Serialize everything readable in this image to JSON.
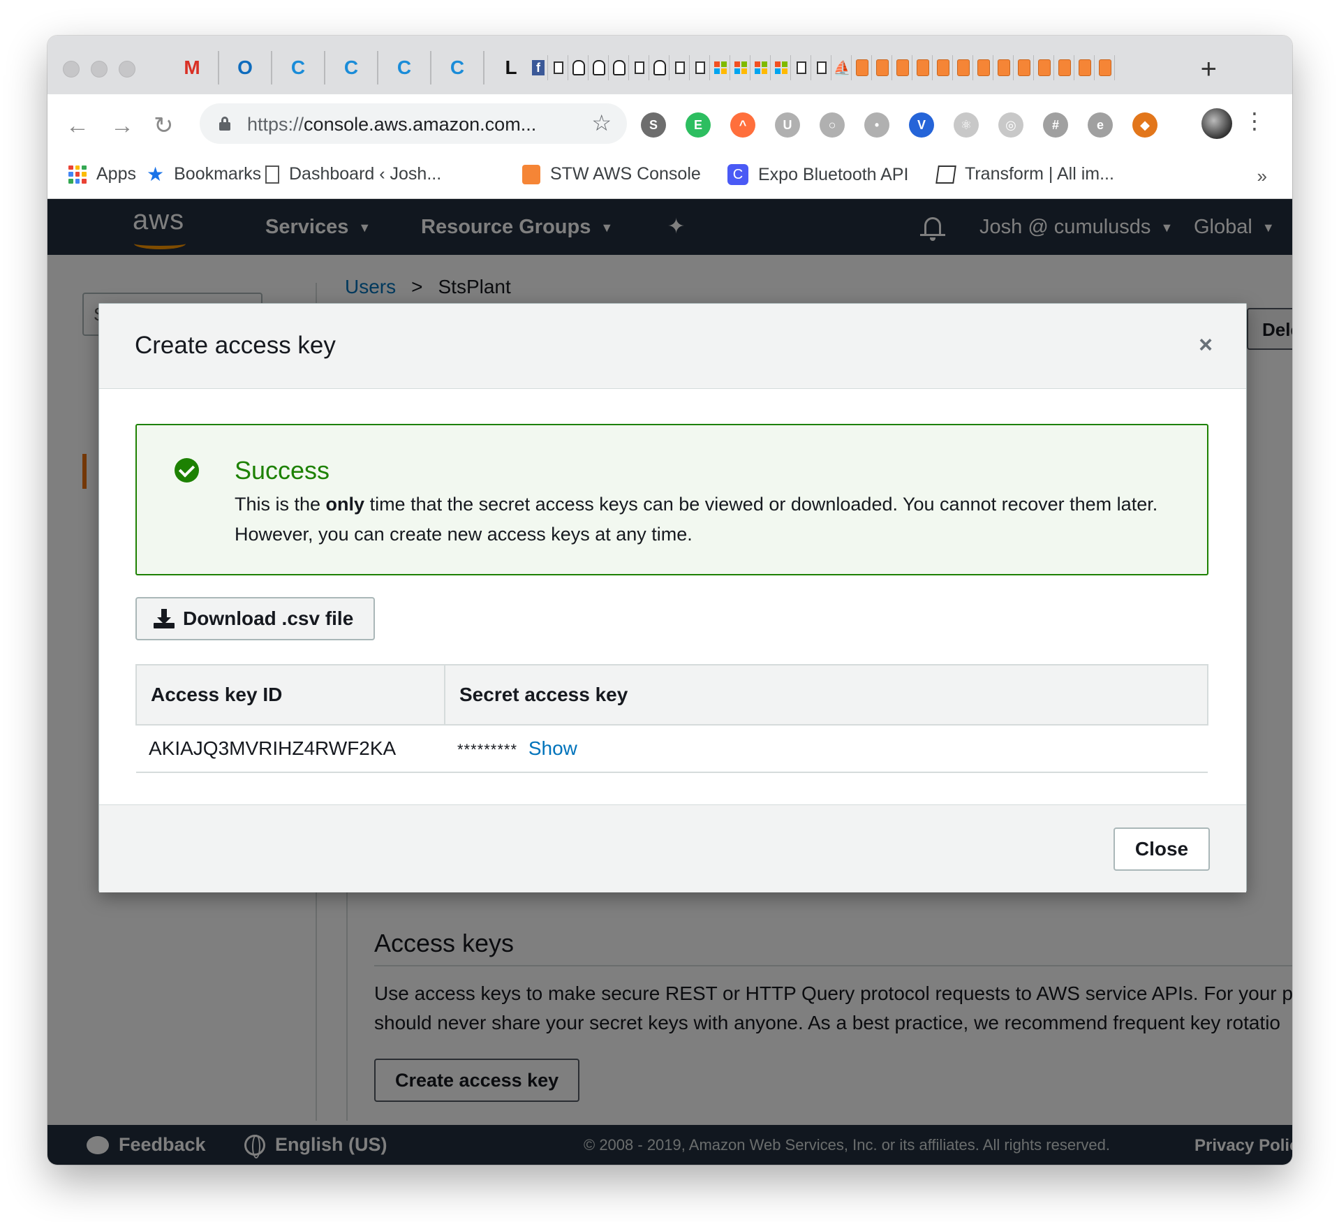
{
  "browser": {
    "pinned_tabs": [
      {
        "icon": "gmail-icon",
        "glyph": "M",
        "color": "#d93025"
      },
      {
        "icon": "outlook-icon",
        "glyph": "O",
        "color": "#0f6cbd"
      },
      {
        "icon": "c-app-icon",
        "glyph": "C",
        "color": "#1a8cd8"
      },
      {
        "icon": "c-app-icon",
        "glyph": "C",
        "color": "#1a8cd8"
      },
      {
        "icon": "c-app-icon",
        "glyph": "C",
        "color": "#1a8cd8"
      },
      {
        "icon": "c-app-icon",
        "glyph": "C",
        "color": "#1a8cd8"
      },
      {
        "icon": "l-app-icon",
        "glyph": "L",
        "color": "#111111"
      }
    ],
    "mini_tabs": [
      "facebook",
      "doc",
      "helmet",
      "helmet",
      "helmet",
      "doc",
      "helmet",
      "doc",
      "doc",
      "ms",
      "ms",
      "ms",
      "ms",
      "doc",
      "doc",
      "sail",
      "cube",
      "cube",
      "cube",
      "cube",
      "cube",
      "cube",
      "cube",
      "cube",
      "cube",
      "cube",
      "cube",
      "cube",
      "cube"
    ],
    "url_scheme": "https://",
    "url_rest": "console.aws.amazon.com...",
    "extensions": [
      {
        "icon": "s-extension-icon",
        "glyph": "S",
        "bg": "#6d6d6d"
      },
      {
        "icon": "evernote-icon",
        "glyph": "E",
        "bg": "#2dbe60"
      },
      {
        "icon": "rainbow-icon",
        "glyph": "^",
        "bg": "#ff6f3c"
      },
      {
        "icon": "u-extension-icon",
        "glyph": "U",
        "bg": "#b0b0b0"
      },
      {
        "icon": "circle-extension-icon",
        "glyph": "○",
        "bg": "#b0b0b0"
      },
      {
        "icon": "dot-extension-icon",
        "glyph": "•",
        "bg": "#b0b0b0"
      },
      {
        "icon": "vue-extension-icon",
        "glyph": "V",
        "bg": "#2564d8"
      },
      {
        "icon": "react-extension-icon",
        "glyph": "⚛",
        "bg": "#c8c8c8"
      },
      {
        "icon": "target-extension-icon",
        "glyph": "◎",
        "bg": "#c8c8c8"
      },
      {
        "icon": "tag-extension-icon",
        "glyph": "#",
        "bg": "#a0a0a0"
      },
      {
        "icon": "e-extension-icon",
        "glyph": "e",
        "bg": "#a0a0a0"
      },
      {
        "icon": "metamask-icon",
        "glyph": "◆",
        "bg": "#e2761b"
      }
    ],
    "bookmarks": [
      {
        "label": "Apps",
        "icon": "apps-grid-icon"
      },
      {
        "label": "Bookmarks",
        "icon": "star-icon"
      },
      {
        "label": "Dashboard ‹ Josh...",
        "icon": "page-icon"
      },
      {
        "label": "STW AWS Console",
        "icon": "aws-cube-icon"
      },
      {
        "label": "Expo Bluetooth API",
        "icon": "c-bookmark-icon"
      },
      {
        "label": "Transform | All im...",
        "icon": "transform-icon"
      }
    ],
    "bookmarks_more": "»"
  },
  "aws": {
    "logo_text": "aws",
    "nav": {
      "services": "Services",
      "resource_groups": "Resource Groups",
      "account": "Josh @ cumulusds",
      "region": "Global"
    },
    "search_placeholder": "Search IAM",
    "breadcrumb": {
      "users": "Users",
      "separator": ">",
      "current": "StsPlant"
    },
    "delete_button": "Dele",
    "access_keys": {
      "title": "Access keys",
      "desc_line1": "Use access keys to make secure REST or HTTP Query protocol requests to AWS service APIs. For your p",
      "desc_line2": "should never share your secret keys with anyone. As a best practice, we recommend frequent key rotatio",
      "create_button": "Create access key"
    },
    "footer": {
      "feedback": "Feedback",
      "language": "English (US)",
      "copyright": "© 2008 - 2019, Amazon Web Services, Inc. or its affiliates. All rights reserved.",
      "privacy": "Privacy Polic"
    }
  },
  "modal": {
    "title": "Create access key",
    "close_glyph": "×",
    "alert": {
      "title": "Success",
      "body_pre": "This is the ",
      "body_bold": "only",
      "body_post": " time that the secret access keys can be viewed or downloaded. You cannot recover them later. However, you can create new access keys at any time."
    },
    "download_button": "Download .csv file",
    "table": {
      "headers": [
        "Access key ID",
        "Secret access key"
      ],
      "rows": [
        {
          "access_key_id": "AKIAJQ3MVRIHZ4RWF2KA",
          "secret_masked": "*********",
          "show_label": "Show"
        }
      ]
    },
    "close_button": "Close"
  }
}
